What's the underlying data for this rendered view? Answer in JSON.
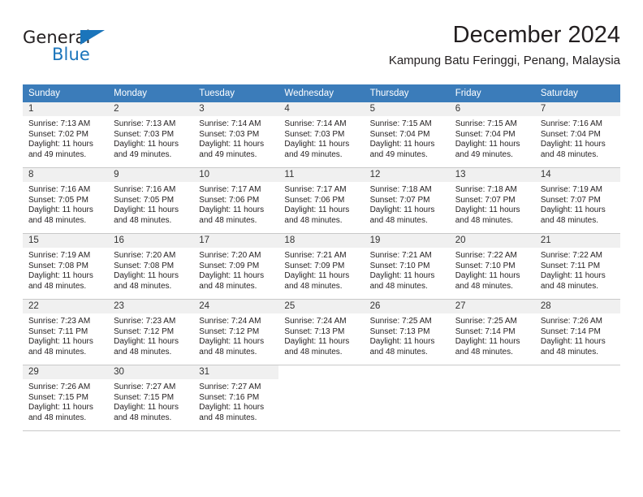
{
  "brand": {
    "name_part1": "General",
    "name_part2": "Blue",
    "logo_icon": "triangle-icon",
    "color_primary": "#1b75bb",
    "color_dark": "#231f20"
  },
  "header": {
    "title": "December 2024",
    "subtitle": "Kampung Batu Feringgi, Penang, Malaysia"
  },
  "colors": {
    "header_band": "#3b7cba",
    "daynum_band": "#f0f0f0",
    "grid_line": "#c9c9c9",
    "text": "#231f20"
  },
  "calendar": {
    "weekday_headers": [
      "Sunday",
      "Monday",
      "Tuesday",
      "Wednesday",
      "Thursday",
      "Friday",
      "Saturday"
    ],
    "weeks": [
      [
        {
          "day": "1",
          "sunrise": "Sunrise: 7:13 AM",
          "sunset": "Sunset: 7:02 PM",
          "daylight1": "Daylight: 11 hours",
          "daylight2": "and 49 minutes."
        },
        {
          "day": "2",
          "sunrise": "Sunrise: 7:13 AM",
          "sunset": "Sunset: 7:03 PM",
          "daylight1": "Daylight: 11 hours",
          "daylight2": "and 49 minutes."
        },
        {
          "day": "3",
          "sunrise": "Sunrise: 7:14 AM",
          "sunset": "Sunset: 7:03 PM",
          "daylight1": "Daylight: 11 hours",
          "daylight2": "and 49 minutes."
        },
        {
          "day": "4",
          "sunrise": "Sunrise: 7:14 AM",
          "sunset": "Sunset: 7:03 PM",
          "daylight1": "Daylight: 11 hours",
          "daylight2": "and 49 minutes."
        },
        {
          "day": "5",
          "sunrise": "Sunrise: 7:15 AM",
          "sunset": "Sunset: 7:04 PM",
          "daylight1": "Daylight: 11 hours",
          "daylight2": "and 49 minutes."
        },
        {
          "day": "6",
          "sunrise": "Sunrise: 7:15 AM",
          "sunset": "Sunset: 7:04 PM",
          "daylight1": "Daylight: 11 hours",
          "daylight2": "and 49 minutes."
        },
        {
          "day": "7",
          "sunrise": "Sunrise: 7:16 AM",
          "sunset": "Sunset: 7:04 PM",
          "daylight1": "Daylight: 11 hours",
          "daylight2": "and 48 minutes."
        }
      ],
      [
        {
          "day": "8",
          "sunrise": "Sunrise: 7:16 AM",
          "sunset": "Sunset: 7:05 PM",
          "daylight1": "Daylight: 11 hours",
          "daylight2": "and 48 minutes."
        },
        {
          "day": "9",
          "sunrise": "Sunrise: 7:16 AM",
          "sunset": "Sunset: 7:05 PM",
          "daylight1": "Daylight: 11 hours",
          "daylight2": "and 48 minutes."
        },
        {
          "day": "10",
          "sunrise": "Sunrise: 7:17 AM",
          "sunset": "Sunset: 7:06 PM",
          "daylight1": "Daylight: 11 hours",
          "daylight2": "and 48 minutes."
        },
        {
          "day": "11",
          "sunrise": "Sunrise: 7:17 AM",
          "sunset": "Sunset: 7:06 PM",
          "daylight1": "Daylight: 11 hours",
          "daylight2": "and 48 minutes."
        },
        {
          "day": "12",
          "sunrise": "Sunrise: 7:18 AM",
          "sunset": "Sunset: 7:07 PM",
          "daylight1": "Daylight: 11 hours",
          "daylight2": "and 48 minutes."
        },
        {
          "day": "13",
          "sunrise": "Sunrise: 7:18 AM",
          "sunset": "Sunset: 7:07 PM",
          "daylight1": "Daylight: 11 hours",
          "daylight2": "and 48 minutes."
        },
        {
          "day": "14",
          "sunrise": "Sunrise: 7:19 AM",
          "sunset": "Sunset: 7:07 PM",
          "daylight1": "Daylight: 11 hours",
          "daylight2": "and 48 minutes."
        }
      ],
      [
        {
          "day": "15",
          "sunrise": "Sunrise: 7:19 AM",
          "sunset": "Sunset: 7:08 PM",
          "daylight1": "Daylight: 11 hours",
          "daylight2": "and 48 minutes."
        },
        {
          "day": "16",
          "sunrise": "Sunrise: 7:20 AM",
          "sunset": "Sunset: 7:08 PM",
          "daylight1": "Daylight: 11 hours",
          "daylight2": "and 48 minutes."
        },
        {
          "day": "17",
          "sunrise": "Sunrise: 7:20 AM",
          "sunset": "Sunset: 7:09 PM",
          "daylight1": "Daylight: 11 hours",
          "daylight2": "and 48 minutes."
        },
        {
          "day": "18",
          "sunrise": "Sunrise: 7:21 AM",
          "sunset": "Sunset: 7:09 PM",
          "daylight1": "Daylight: 11 hours",
          "daylight2": "and 48 minutes."
        },
        {
          "day": "19",
          "sunrise": "Sunrise: 7:21 AM",
          "sunset": "Sunset: 7:10 PM",
          "daylight1": "Daylight: 11 hours",
          "daylight2": "and 48 minutes."
        },
        {
          "day": "20",
          "sunrise": "Sunrise: 7:22 AM",
          "sunset": "Sunset: 7:10 PM",
          "daylight1": "Daylight: 11 hours",
          "daylight2": "and 48 minutes."
        },
        {
          "day": "21",
          "sunrise": "Sunrise: 7:22 AM",
          "sunset": "Sunset: 7:11 PM",
          "daylight1": "Daylight: 11 hours",
          "daylight2": "and 48 minutes."
        }
      ],
      [
        {
          "day": "22",
          "sunrise": "Sunrise: 7:23 AM",
          "sunset": "Sunset: 7:11 PM",
          "daylight1": "Daylight: 11 hours",
          "daylight2": "and 48 minutes."
        },
        {
          "day": "23",
          "sunrise": "Sunrise: 7:23 AM",
          "sunset": "Sunset: 7:12 PM",
          "daylight1": "Daylight: 11 hours",
          "daylight2": "and 48 minutes."
        },
        {
          "day": "24",
          "sunrise": "Sunrise: 7:24 AM",
          "sunset": "Sunset: 7:12 PM",
          "daylight1": "Daylight: 11 hours",
          "daylight2": "and 48 minutes."
        },
        {
          "day": "25",
          "sunrise": "Sunrise: 7:24 AM",
          "sunset": "Sunset: 7:13 PM",
          "daylight1": "Daylight: 11 hours",
          "daylight2": "and 48 minutes."
        },
        {
          "day": "26",
          "sunrise": "Sunrise: 7:25 AM",
          "sunset": "Sunset: 7:13 PM",
          "daylight1": "Daylight: 11 hours",
          "daylight2": "and 48 minutes."
        },
        {
          "day": "27",
          "sunrise": "Sunrise: 7:25 AM",
          "sunset": "Sunset: 7:14 PM",
          "daylight1": "Daylight: 11 hours",
          "daylight2": "and 48 minutes."
        },
        {
          "day": "28",
          "sunrise": "Sunrise: 7:26 AM",
          "sunset": "Sunset: 7:14 PM",
          "daylight1": "Daylight: 11 hours",
          "daylight2": "and 48 minutes."
        }
      ],
      [
        {
          "day": "29",
          "sunrise": "Sunrise: 7:26 AM",
          "sunset": "Sunset: 7:15 PM",
          "daylight1": "Daylight: 11 hours",
          "daylight2": "and 48 minutes."
        },
        {
          "day": "30",
          "sunrise": "Sunrise: 7:27 AM",
          "sunset": "Sunset: 7:15 PM",
          "daylight1": "Daylight: 11 hours",
          "daylight2": "and 48 minutes."
        },
        {
          "day": "31",
          "sunrise": "Sunrise: 7:27 AM",
          "sunset": "Sunset: 7:16 PM",
          "daylight1": "Daylight: 11 hours",
          "daylight2": "and 48 minutes."
        },
        {
          "day": "",
          "sunrise": "",
          "sunset": "",
          "daylight1": "",
          "daylight2": ""
        },
        {
          "day": "",
          "sunrise": "",
          "sunset": "",
          "daylight1": "",
          "daylight2": ""
        },
        {
          "day": "",
          "sunrise": "",
          "sunset": "",
          "daylight1": "",
          "daylight2": ""
        },
        {
          "day": "",
          "sunrise": "",
          "sunset": "",
          "daylight1": "",
          "daylight2": ""
        }
      ]
    ]
  }
}
